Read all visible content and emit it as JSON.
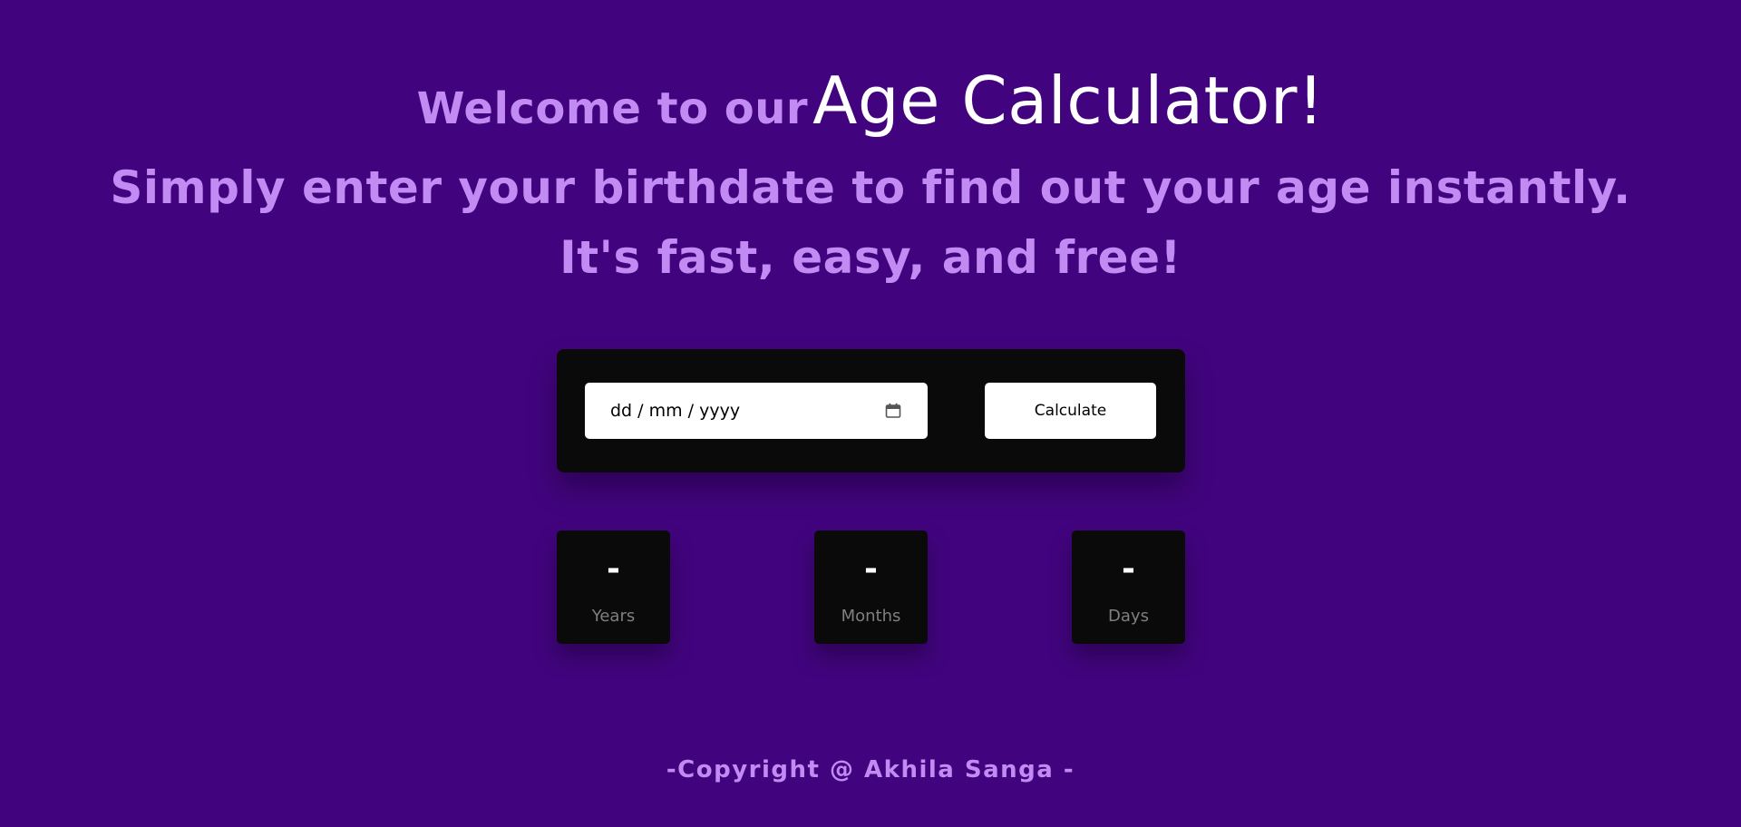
{
  "header": {
    "welcome_text": "Welcome to our",
    "title": "Age Calculator!",
    "subtitle_line1": "Simply enter your birthdate to find out your age instantly.",
    "subtitle_line2": "It's fast, easy, and free!"
  },
  "form": {
    "date_placeholder": "dd / mm / yyyy",
    "date_value": "",
    "calendar_icon": "calendar-icon",
    "calculate_label": "Calculate"
  },
  "results": [
    {
      "value": "-",
      "label": "Years"
    },
    {
      "value": "-",
      "label": "Months"
    },
    {
      "value": "-",
      "label": "Days"
    }
  ],
  "footer": {
    "copyright": "-Copyright @ Akhila Sanga -"
  },
  "colors": {
    "background": "#42047e",
    "accent_text": "#c28bf3",
    "card": "#0b0a0b",
    "title": "#ffffff",
    "muted_label": "#7f7f7f"
  }
}
